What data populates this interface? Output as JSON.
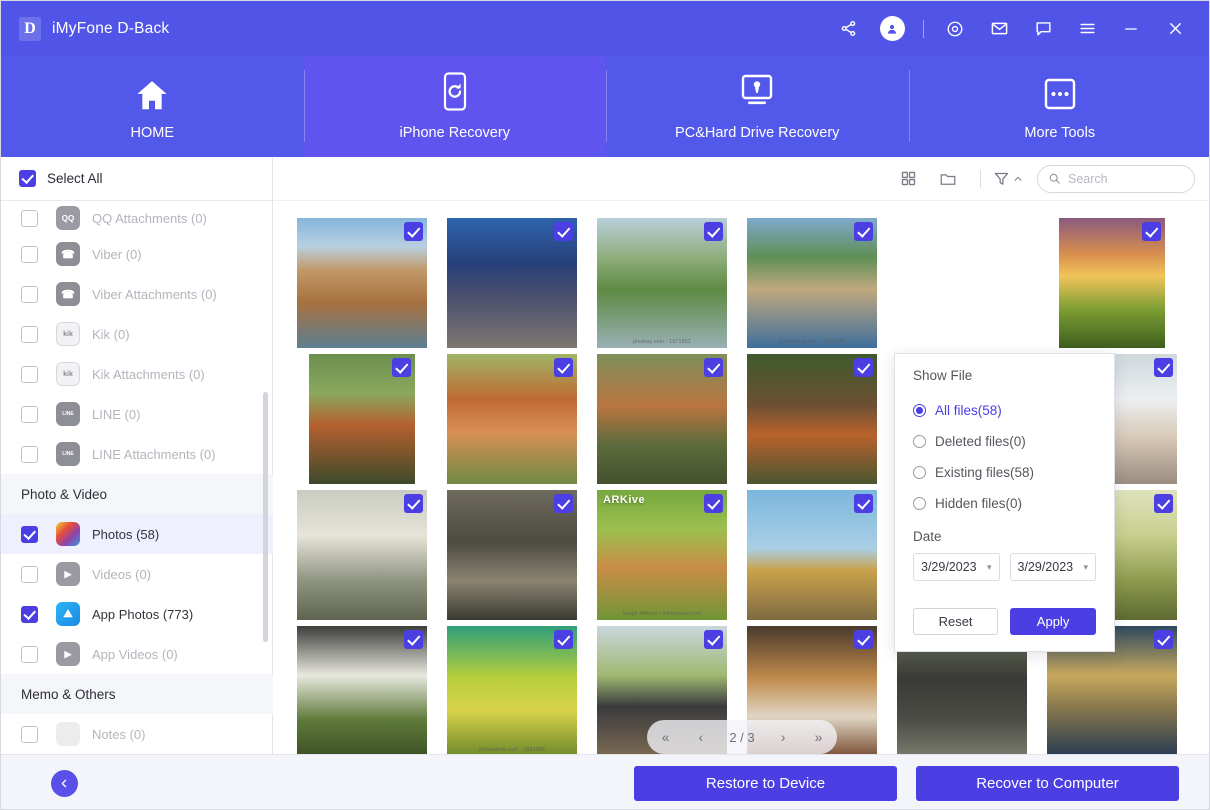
{
  "window": {
    "logo_letter": "D",
    "title": "iMyFone D-Back",
    "controls": [
      {
        "name": "share-icon",
        "label": "Share"
      },
      {
        "name": "account-avatar",
        "label": "Account"
      },
      {
        "name": "target-icon",
        "label": "Record"
      },
      {
        "name": "mail-icon",
        "label": "Mail"
      },
      {
        "name": "chat-icon",
        "label": "Feedback"
      },
      {
        "name": "menu-icon",
        "label": "Menu"
      },
      {
        "name": "minimize-button",
        "label": "Minimize"
      },
      {
        "name": "close-button",
        "label": "Close"
      }
    ]
  },
  "nav": {
    "tabs": [
      {
        "label": "HOME",
        "icon": "home-icon",
        "active": false
      },
      {
        "label": "iPhone Recovery",
        "icon": "phone-refresh-icon",
        "active": true
      },
      {
        "label": "PC&Hard Drive Recovery",
        "icon": "monitor-icon",
        "active": false
      },
      {
        "label": "More Tools",
        "icon": "more-dots-icon",
        "active": false
      }
    ]
  },
  "sidebar": {
    "select_all_label": "Select All",
    "select_all_checked": true,
    "items": [
      {
        "type": "item",
        "label": "QQ Attachments (0)",
        "icon": "qq-icon",
        "checked": false,
        "enabled": false,
        "selected": false,
        "partial": true
      },
      {
        "type": "item",
        "label": "Viber (0)",
        "icon": "viber-icon",
        "checked": false,
        "enabled": false,
        "selected": false
      },
      {
        "type": "item",
        "label": "Viber Attachments (0)",
        "icon": "viber-icon",
        "checked": false,
        "enabled": false,
        "selected": false
      },
      {
        "type": "item",
        "label": "Kik (0)",
        "icon": "kik-icon",
        "checked": false,
        "enabled": false,
        "selected": false
      },
      {
        "type": "item",
        "label": "Kik Attachments (0)",
        "icon": "kik-icon",
        "checked": false,
        "enabled": false,
        "selected": false
      },
      {
        "type": "item",
        "label": "LINE (0)",
        "icon": "line-icon",
        "checked": false,
        "enabled": false,
        "selected": false
      },
      {
        "type": "item",
        "label": "LINE Attachments (0)",
        "icon": "line-icon",
        "checked": false,
        "enabled": false,
        "selected": false
      },
      {
        "type": "section",
        "label": "Photo & Video"
      },
      {
        "type": "item",
        "label": "Photos (58)",
        "icon": "photos-icon",
        "checked": true,
        "enabled": true,
        "selected": true
      },
      {
        "type": "item",
        "label": "Videos (0)",
        "icon": "videos-icon",
        "checked": false,
        "enabled": false,
        "selected": false
      },
      {
        "type": "item",
        "label": "App Photos (773)",
        "icon": "app-photos-icon",
        "checked": true,
        "enabled": true,
        "selected": false
      },
      {
        "type": "item",
        "label": "App Videos (0)",
        "icon": "app-videos-icon",
        "checked": false,
        "enabled": false,
        "selected": false
      },
      {
        "type": "section",
        "label": "Memo & Others"
      },
      {
        "type": "item",
        "label": "Notes (0)",
        "icon": "notes-icon",
        "checked": false,
        "enabled": false,
        "selected": false
      }
    ]
  },
  "toolbar": {
    "grid_view_icon": "grid-view-icon",
    "folder_view_icon": "folder-view-icon",
    "filter_icon": "filter-icon",
    "filter_chevron": "chevron-up-icon",
    "search_placeholder": "Search",
    "search_value": ""
  },
  "filter_panel": {
    "show_file_title": "Show File",
    "options": [
      {
        "label": "All files(58)",
        "selected": true
      },
      {
        "label": "Deleted files(0)",
        "selected": false
      },
      {
        "label": "Existing files(58)",
        "selected": false
      },
      {
        "label": "Hidden files(0)",
        "selected": false
      }
    ],
    "date_title": "Date",
    "date_from": "3/29/2023",
    "date_to": "3/29/2023",
    "reset_label": "Reset",
    "apply_label": "Apply"
  },
  "pagination": {
    "first_label": "«",
    "prev_label": "‹",
    "page_text": "2 / 3",
    "next_label": "›",
    "last_label": "»"
  },
  "grid": {
    "thumbnails": [
      {
        "alt": "coastal village with stone buildings",
        "tall": false,
        "checked": true,
        "style": "linear-gradient(180deg,#86b6dd 0%,#b8cfe0 22%,#c2996a 40%,#a8713f 65%,#5d7f92 100%)"
      },
      {
        "alt": "mountain town at dusk",
        "tall": false,
        "checked": true,
        "style": "linear-gradient(180deg,#2e63ad 0%,#27407a 35%,#4a4f6e 60%,#7d7670 100%)"
      },
      {
        "alt": "tree beside river landscape",
        "tall": false,
        "checked": true,
        "watermark": "pixabay.com - 1571801",
        "style": "linear-gradient(180deg,#b9cfdb 0%,#8fae7c 30%,#5e8a42 55%,#98b0b5 100%)"
      },
      {
        "alt": "lakeside town with boat",
        "tall": false,
        "checked": true,
        "watermark": "dollarstock.com - 2868365",
        "style": "linear-gradient(180deg,#7fa9cf 0%,#5f8f54 30%,#c0a87e 55%,#3f6f9c 100%)"
      },
      {
        "alt": "blank placeholder",
        "tall": false,
        "checked": false,
        "blank": true,
        "style": "#ffffff"
      },
      {
        "alt": "sunset over grassy hills",
        "tall": true,
        "checked": true,
        "style": "linear-gradient(180deg,#8a5a7e 0%,#d98f4e 28%,#f0c45a 45%,#7d9e33 70%,#3e5e1e 100%)"
      },
      {
        "alt": "red panda in snowy tree",
        "tall": true,
        "checked": true,
        "style": "linear-gradient(180deg,#6c8f4e 0%,#8aa95f 30%,#b5602e 55%,#3c4a2c 100%)"
      },
      {
        "alt": "red panda eating bamboo",
        "tall": false,
        "checked": true,
        "style": "linear-gradient(180deg,#9fb567 0%,#c06a33 35%,#d98f55 60%,#6f8a44 100%)"
      },
      {
        "alt": "red panda standing",
        "tall": false,
        "checked": true,
        "style": "linear-gradient(180deg,#7e8f5a 0%,#b97440 40%,#5c6b3c 70%,#45502e 100%)"
      },
      {
        "alt": "red panda on logs",
        "tall": false,
        "checked": true,
        "style": "linear-gradient(180deg,#3f5a2e 0%,#6d5033 40%,#b9622c 62%,#4a5530 100%)"
      },
      {
        "alt": "blank placeholder",
        "tall": false,
        "checked": false,
        "blank": true,
        "style": "#ffffff"
      },
      {
        "alt": "polar bear cub",
        "tall": false,
        "checked": true,
        "style": "linear-gradient(180deg,#cfd8dc 0%,#eceff1 35%,#d7c8b5 65%,#9a8d80 100%)"
      },
      {
        "alt": "white tiger resting",
        "tall": false,
        "checked": true,
        "style": "linear-gradient(180deg,#c9ccc2 0%,#e7e3d8 35%,#8e9480 70%,#5e6450 100%)"
      },
      {
        "alt": "mountain goat with horns",
        "tall": false,
        "checked": true,
        "style": "linear-gradient(180deg,#6e6a5e 0%,#4d4a42 40%,#8a8470 70%,#3b3a32 100%)"
      },
      {
        "alt": "caracal lynx snarling",
        "tall": false,
        "checked": true,
        "watermark_top": "ARKive",
        "watermark": "Image ARKive / wildscreen.com",
        "style": "linear-gradient(180deg,#76a83e 0%,#9bc04f 30%,#c98c46 60%,#6f9636 100%)"
      },
      {
        "alt": "buoy floating on water",
        "tall": false,
        "checked": true,
        "style": "linear-gradient(180deg,#7bb6dd 0%,#a9cfe4 45%,#c9a14a 62%,#7e6a42 100%)"
      },
      {
        "alt": "black bull in field",
        "tall": true,
        "checked": true,
        "style": "linear-gradient(180deg,#5d7a3a 0%,#2a2a26 40%,#3c4a2a 70%,#6b7f3e 100%)"
      },
      {
        "alt": "green sea creature close-up",
        "tall": false,
        "checked": true,
        "style": "linear-gradient(180deg,#dfe3bd 0%,#c8cf8e 35%,#8d9a4e 70%,#5d6a32 100%)"
      },
      {
        "alt": "giant panda in grass",
        "tall": false,
        "checked": true,
        "style": "linear-gradient(180deg,#3d3d3a 0%,#e8e8e0 38%,#5f7b3a 72%,#3e5226 100%)"
      },
      {
        "alt": "green and yellow chameleon",
        "tall": false,
        "checked": true,
        "watermark": "dollarstock.com - 2865085",
        "style": "linear-gradient(180deg,#2f9e7a 0%,#b8cf3c 40%,#d8d24a 65%,#6f8a2c 100%)"
      },
      {
        "alt": "horse in stable",
        "tall": false,
        "checked": true,
        "style": "linear-gradient(180deg,#c9d7dd 0%,#9fb871 38%,#3a3a3e 62%,#7a6a52 100%)"
      },
      {
        "alt": "dog in kennel with puppy",
        "tall": false,
        "checked": true,
        "style": "linear-gradient(180deg,#4a3a2c 0%,#c08a4c 40%,#e0d6c4 70%,#7a4f36 100%)"
      },
      {
        "alt": "elephants in river",
        "tall": false,
        "checked": true,
        "style": "linear-gradient(180deg,#6f7a5e 0%,#3a3a36 40%,#4a4a44 70%,#787a6c 100%)"
      },
      {
        "alt": "two meerkats standing",
        "tall": false,
        "checked": true,
        "style": "linear-gradient(180deg,#2e4a5e 0%,#c8a85e 38%,#8a7a4e 62%,#2a3c52 100%)"
      }
    ]
  },
  "footer": {
    "back_icon": "arrow-left-icon",
    "restore_label": "Restore to Device",
    "recover_label": "Recover to Computer"
  },
  "colors": {
    "brand_purple": "#5055e8",
    "nav_purple": "#5258ea",
    "active_tab": "#6054ef",
    "accent": "#4b3fe4",
    "sidebar_selected": "#eef1fd",
    "section_bg": "#f5f6fa",
    "footer_bg": "#f4f5fb"
  }
}
